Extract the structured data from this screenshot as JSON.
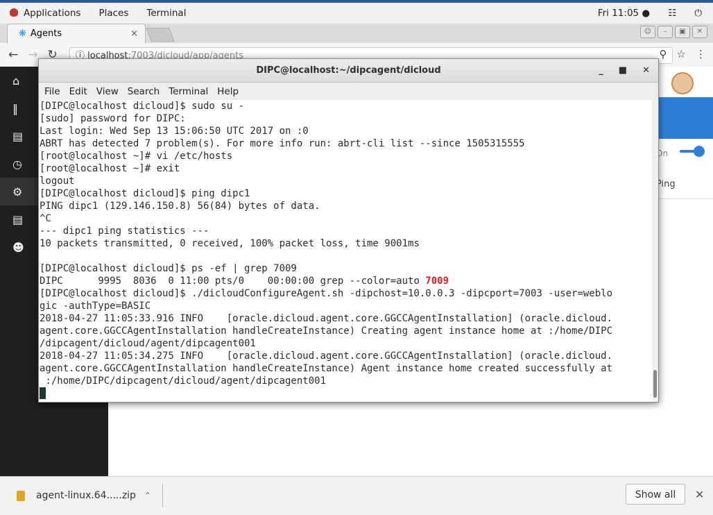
{
  "top_panel": {
    "applications": "Applications",
    "places": "Places",
    "terminal": "Terminal",
    "clock": "Fri 11:05 ●"
  },
  "browser": {
    "tab_title": "Agents",
    "tab_close": "×",
    "url_host": "localhost",
    "url_path": ":7003/dicloud/app/agents"
  },
  "app": {
    "toggle_label": "On",
    "ping_label": "Ping"
  },
  "terminal": {
    "title": "DIPC@localhost:~/dipcagent/dicloud",
    "menu": [
      "File",
      "Edit",
      "View",
      "Search",
      "Terminal",
      "Help"
    ],
    "lines": [
      "[DIPC@localhost dicloud]$ sudo su -",
      "[sudo] password for DIPC:",
      "Last login: Wed Sep 13 15:06:50 UTC 2017 on :0",
      "ABRT has detected 7 problem(s). For more info run: abrt-cli list --since 1505315555",
      "[root@localhost ~]# vi /etc/hosts",
      "[root@localhost ~]# exit",
      "logout",
      "[DIPC@localhost dicloud]$ ping dipc1",
      "PING dipc1 (129.146.150.8) 56(84) bytes of data.",
      "^C",
      "--- dipc1 ping statistics ---",
      "10 packets transmitted, 0 received, 100% packet loss, time 9001ms",
      "",
      "[DIPC@localhost dicloud]$ ps -ef | grep 7009"
    ],
    "grep_line_prefix": "DIPC      9995  8036  0 11:00 pts/0    00:00:00 grep --color=auto ",
    "grep_match": "7009",
    "lines_after": [
      "[DIPC@localhost dicloud]$ ./dicloudConfigureAgent.sh -dipchost=10.0.0.3 -dipcport=7003 -user=weblo",
      "gic -authType=BASIC",
      "2018-04-27 11:05:33.916 INFO    [oracle.dicloud.agent.core.GGCCAgentInstallation] (oracle.dicloud.",
      "agent.core.GGCCAgentInstallation handleCreateInstance) Creating agent instance home at :/home/DIPC",
      "/dipcagent/dicloud/agent/dipcagent001",
      "2018-04-27 11:05:34.275 INFO    [oracle.dicloud.agent.core.GGCCAgentInstallation] (oracle.dicloud.",
      "agent.core.GGCCAgentInstallation handleCreateInstance) Agent instance home created successfully at",
      " :/home/DIPC/dipcagent/dicloud/agent/dipcagent001"
    ]
  },
  "downloads": {
    "file_name": "agent-linux.64.....zip",
    "show_all": "Show all"
  }
}
